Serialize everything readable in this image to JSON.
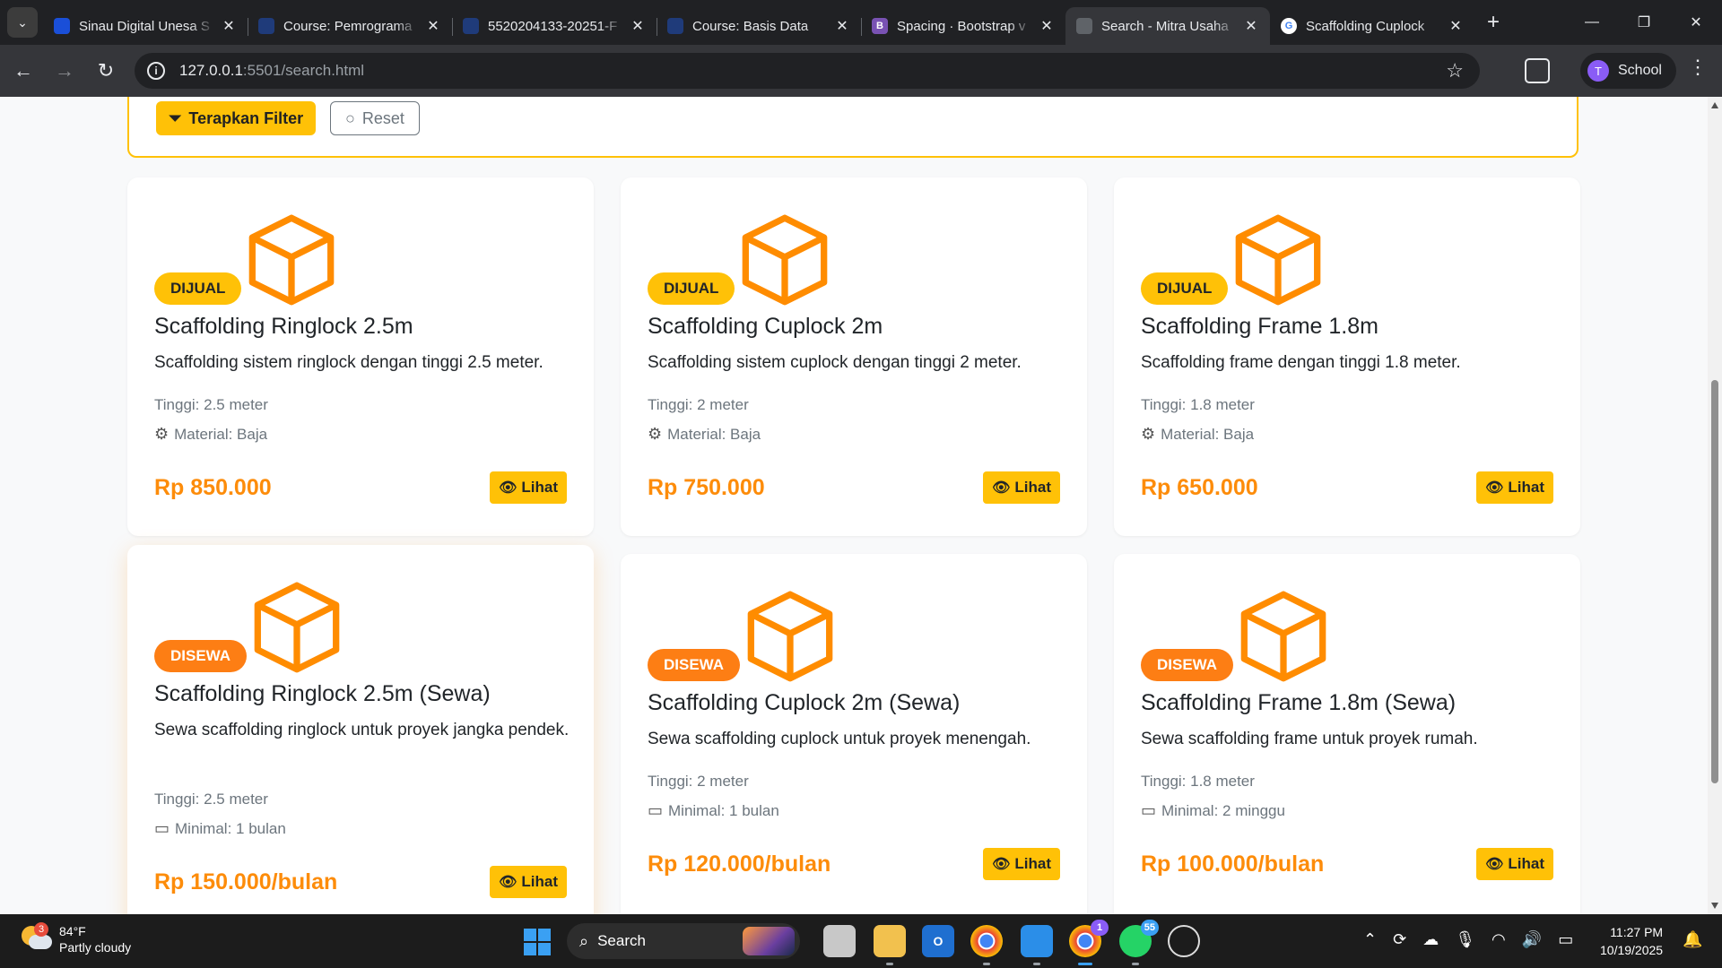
{
  "browser": {
    "tabs": [
      {
        "title": "Sinau Digital Unesa S",
        "fav_color": "#1a4fd8",
        "fav_text": "",
        "active": false
      },
      {
        "title": "Course: Pemrograma",
        "fav_color": "#1f3b7a",
        "fav_text": "",
        "active": false
      },
      {
        "title": "5520204133-20251-F",
        "fav_color": "#1f3b7a",
        "fav_text": "",
        "active": false
      },
      {
        "title": "Course: Basis Data",
        "fav_color": "#1f3b7a",
        "fav_text": "",
        "active": false
      },
      {
        "title": "Spacing · Bootstrap v",
        "fav_color": "#7952b3",
        "fav_text": "B",
        "active": false
      },
      {
        "title": "Search - Mitra Usaha",
        "fav_color": "#5f6368",
        "fav_text": "",
        "active": true
      },
      {
        "title": "Scaffolding Cuplock",
        "fav_color": "#ffffff",
        "fav_text": "G",
        "active": false
      }
    ],
    "url_host": "127.0.0.1",
    "url_rest": ":5501/search.html",
    "profile_initial": "T",
    "profile_name": "School"
  },
  "filter": {
    "apply_label": "Terapkan Filter",
    "reset_label": "Reset"
  },
  "products": [
    {
      "badge": "DIJUAL",
      "type": "sale",
      "name": "Scaffolding Ringlock 2.5m",
      "desc": "Scaffolding sistem ringlock dengan tinggi 2.5 meter.",
      "spec1": "Tinggi: 2.5 meter",
      "spec2_icon": "gear-icon",
      "spec2": "Material: Baja",
      "price": "Rp 850.000",
      "view_label": "Lihat"
    },
    {
      "badge": "DIJUAL",
      "type": "sale",
      "name": "Scaffolding Cuplock 2m",
      "desc": "Scaffolding sistem cuplock dengan tinggi 2 meter.",
      "spec1": "Tinggi: 2 meter",
      "spec2_icon": "gear-icon",
      "spec2": "Material: Baja",
      "price": "Rp 750.000",
      "view_label": "Lihat"
    },
    {
      "badge": "DIJUAL",
      "type": "sale",
      "name": "Scaffolding Frame 1.8m",
      "desc": "Scaffolding frame dengan tinggi 1.8 meter.",
      "spec1": "Tinggi: 1.8 meter",
      "spec2_icon": "gear-icon",
      "spec2": "Material: Baja",
      "price": "Rp 650.000",
      "view_label": "Lihat"
    },
    {
      "badge": "DISEWA",
      "type": "rent",
      "name": "Scaffolding Ringlock 2.5m (Sewa)",
      "desc": "Sewa scaffolding ringlock untuk proyek jangka pendek.",
      "spec1": "Tinggi: 2.5 meter",
      "spec2_icon": "calendar-icon",
      "spec2": "Minimal: 1 bulan",
      "price": "Rp 150.000/bulan",
      "view_label": "Lihat"
    },
    {
      "badge": "DISEWA",
      "type": "rent",
      "name": "Scaffolding Cuplock 2m (Sewa)",
      "desc": "Sewa scaffolding cuplock untuk proyek menengah.",
      "spec1": "Tinggi: 2 meter",
      "spec2_icon": "calendar-icon",
      "spec2": "Minimal: 1 bulan",
      "price": "Rp 120.000/bulan",
      "view_label": "Lihat"
    },
    {
      "badge": "DISEWA",
      "type": "rent",
      "name": "Scaffolding Frame 1.8m (Sewa)",
      "desc": "Sewa scaffolding frame untuk proyek rumah.",
      "spec1": "Tinggi: 1.8 meter",
      "spec2_icon": "calendar-icon",
      "spec2": "Minimal: 2 minggu",
      "price": "Rp 100.000/bulan",
      "view_label": "Lihat"
    }
  ],
  "colors": {
    "accent_yellow": "#ffc107",
    "accent_orange": "#fd7e14",
    "price_orange": "#fd8c0a"
  },
  "taskbar": {
    "weather_temp": "84°F",
    "weather_desc": "Partly cloudy",
    "weather_badge": "3",
    "search_label": "Search",
    "chrome_badge": "1",
    "whatsapp_badge": "55",
    "time": "11:27 PM",
    "date": "10/19/2025"
  }
}
